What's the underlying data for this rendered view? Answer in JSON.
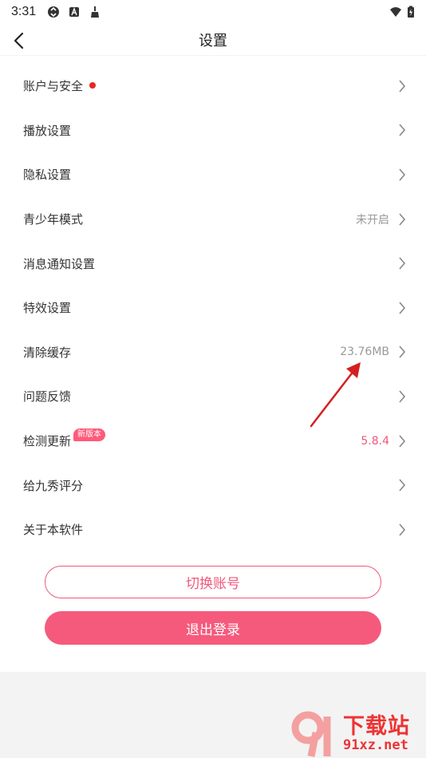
{
  "status_bar": {
    "time": "3:31",
    "left_icons": [
      "sync-icon",
      "a-box-icon",
      "broom-icon"
    ],
    "right_icons": [
      "wifi-icon",
      "battery-charging-icon"
    ]
  },
  "header": {
    "title": "设置"
  },
  "settings": {
    "items": [
      {
        "label": "账户与安全",
        "value": "",
        "red_dot": true
      },
      {
        "label": "播放设置",
        "value": ""
      },
      {
        "label": "隐私设置",
        "value": ""
      },
      {
        "label": "青少年模式",
        "value": "未开启"
      },
      {
        "label": "消息通知设置",
        "value": ""
      },
      {
        "label": "特效设置",
        "value": ""
      },
      {
        "label": "清除缓存",
        "value": "23.76MB"
      },
      {
        "label": "问题反馈",
        "value": ""
      },
      {
        "label": "检测更新",
        "value": "5.8.4",
        "badge": "新版本"
      },
      {
        "label": "给九秀评分",
        "value": ""
      },
      {
        "label": "关于本软件",
        "value": ""
      }
    ]
  },
  "buttons": {
    "switch_account": "切换账号",
    "logout": "退出登录"
  },
  "watermark": {
    "cn": "下载站",
    "en": "91xz.net"
  },
  "colors": {
    "accent": "#f0577d",
    "logout_bg": "#f55a7c",
    "red_dot": "#e8281e",
    "badge_bg": "#ff5a7a",
    "annotation_arrow": "#d42020",
    "watermark": "#e33333"
  }
}
